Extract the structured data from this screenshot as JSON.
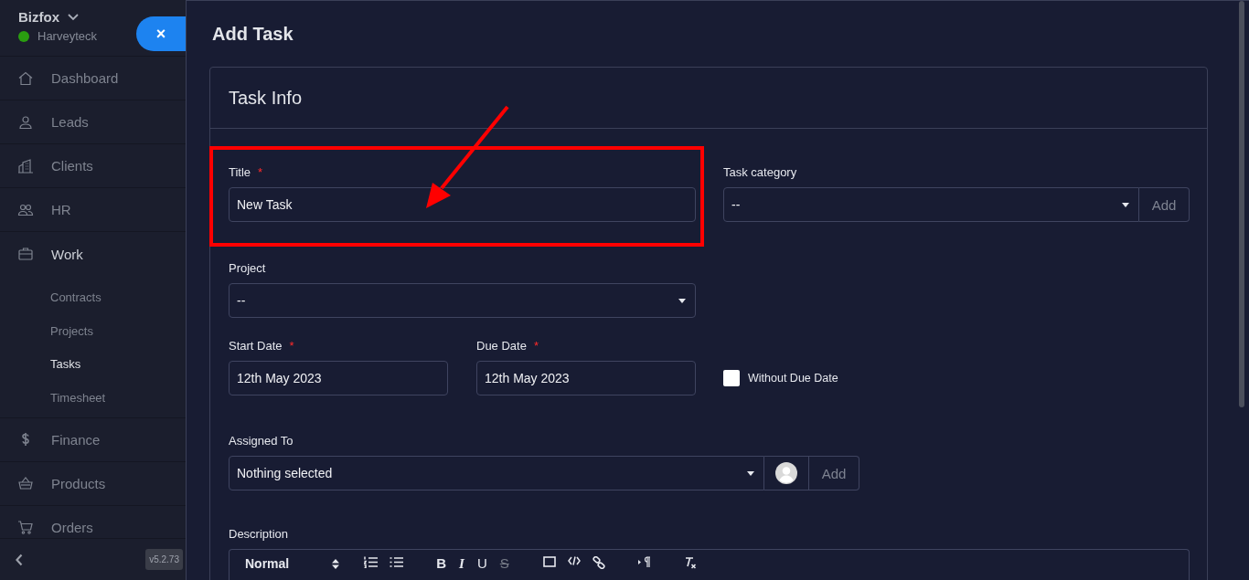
{
  "sidebar": {
    "company": "Bizfox",
    "user": "Harveyteck",
    "online": true,
    "close_button": "×",
    "items": [
      {
        "label": "Dashboard",
        "selected": false
      },
      {
        "label": "Leads",
        "selected": false
      },
      {
        "label": "Clients",
        "selected": false
      },
      {
        "label": "HR",
        "selected": false
      },
      {
        "label": "Work",
        "selected": false,
        "expanded": true,
        "children": [
          {
            "label": "Contracts",
            "selected": false
          },
          {
            "label": "Projects",
            "selected": false
          },
          {
            "label": "Tasks",
            "selected": true
          },
          {
            "label": "Timesheet",
            "selected": false
          }
        ]
      },
      {
        "label": "Finance",
        "selected": false
      },
      {
        "label": "Products",
        "selected": false
      },
      {
        "label": "Orders",
        "selected": false
      }
    ],
    "version": "v5.2.73"
  },
  "page": {
    "title": "Add Task"
  },
  "card": {
    "title": "Task Info"
  },
  "form": {
    "title": {
      "label": "Title",
      "marker": "*",
      "value": "New Task"
    },
    "task_category": {
      "label": "Task category",
      "value": "--",
      "add_button": "Add"
    },
    "project": {
      "label": "Project",
      "value": "--"
    },
    "start_date": {
      "label": "Start Date",
      "marker": "*",
      "value": "12th May 2023"
    },
    "due_date": {
      "label": "Due Date",
      "marker": "*",
      "value": "12th May 2023"
    },
    "without_due_date": {
      "label": "Without Due Date",
      "checked": false
    },
    "assigned_to": {
      "label": "Assigned To",
      "value": "Nothing selected",
      "add_button": "Add"
    },
    "description": {
      "label": "Description",
      "format": "Normal",
      "buttons": [
        {
          "kind": "bold",
          "label": "B"
        },
        {
          "kind": "italic",
          "label": "I"
        },
        {
          "kind": "underline",
          "label": "U"
        },
        {
          "kind": "strike",
          "label": "S"
        }
      ]
    }
  }
}
